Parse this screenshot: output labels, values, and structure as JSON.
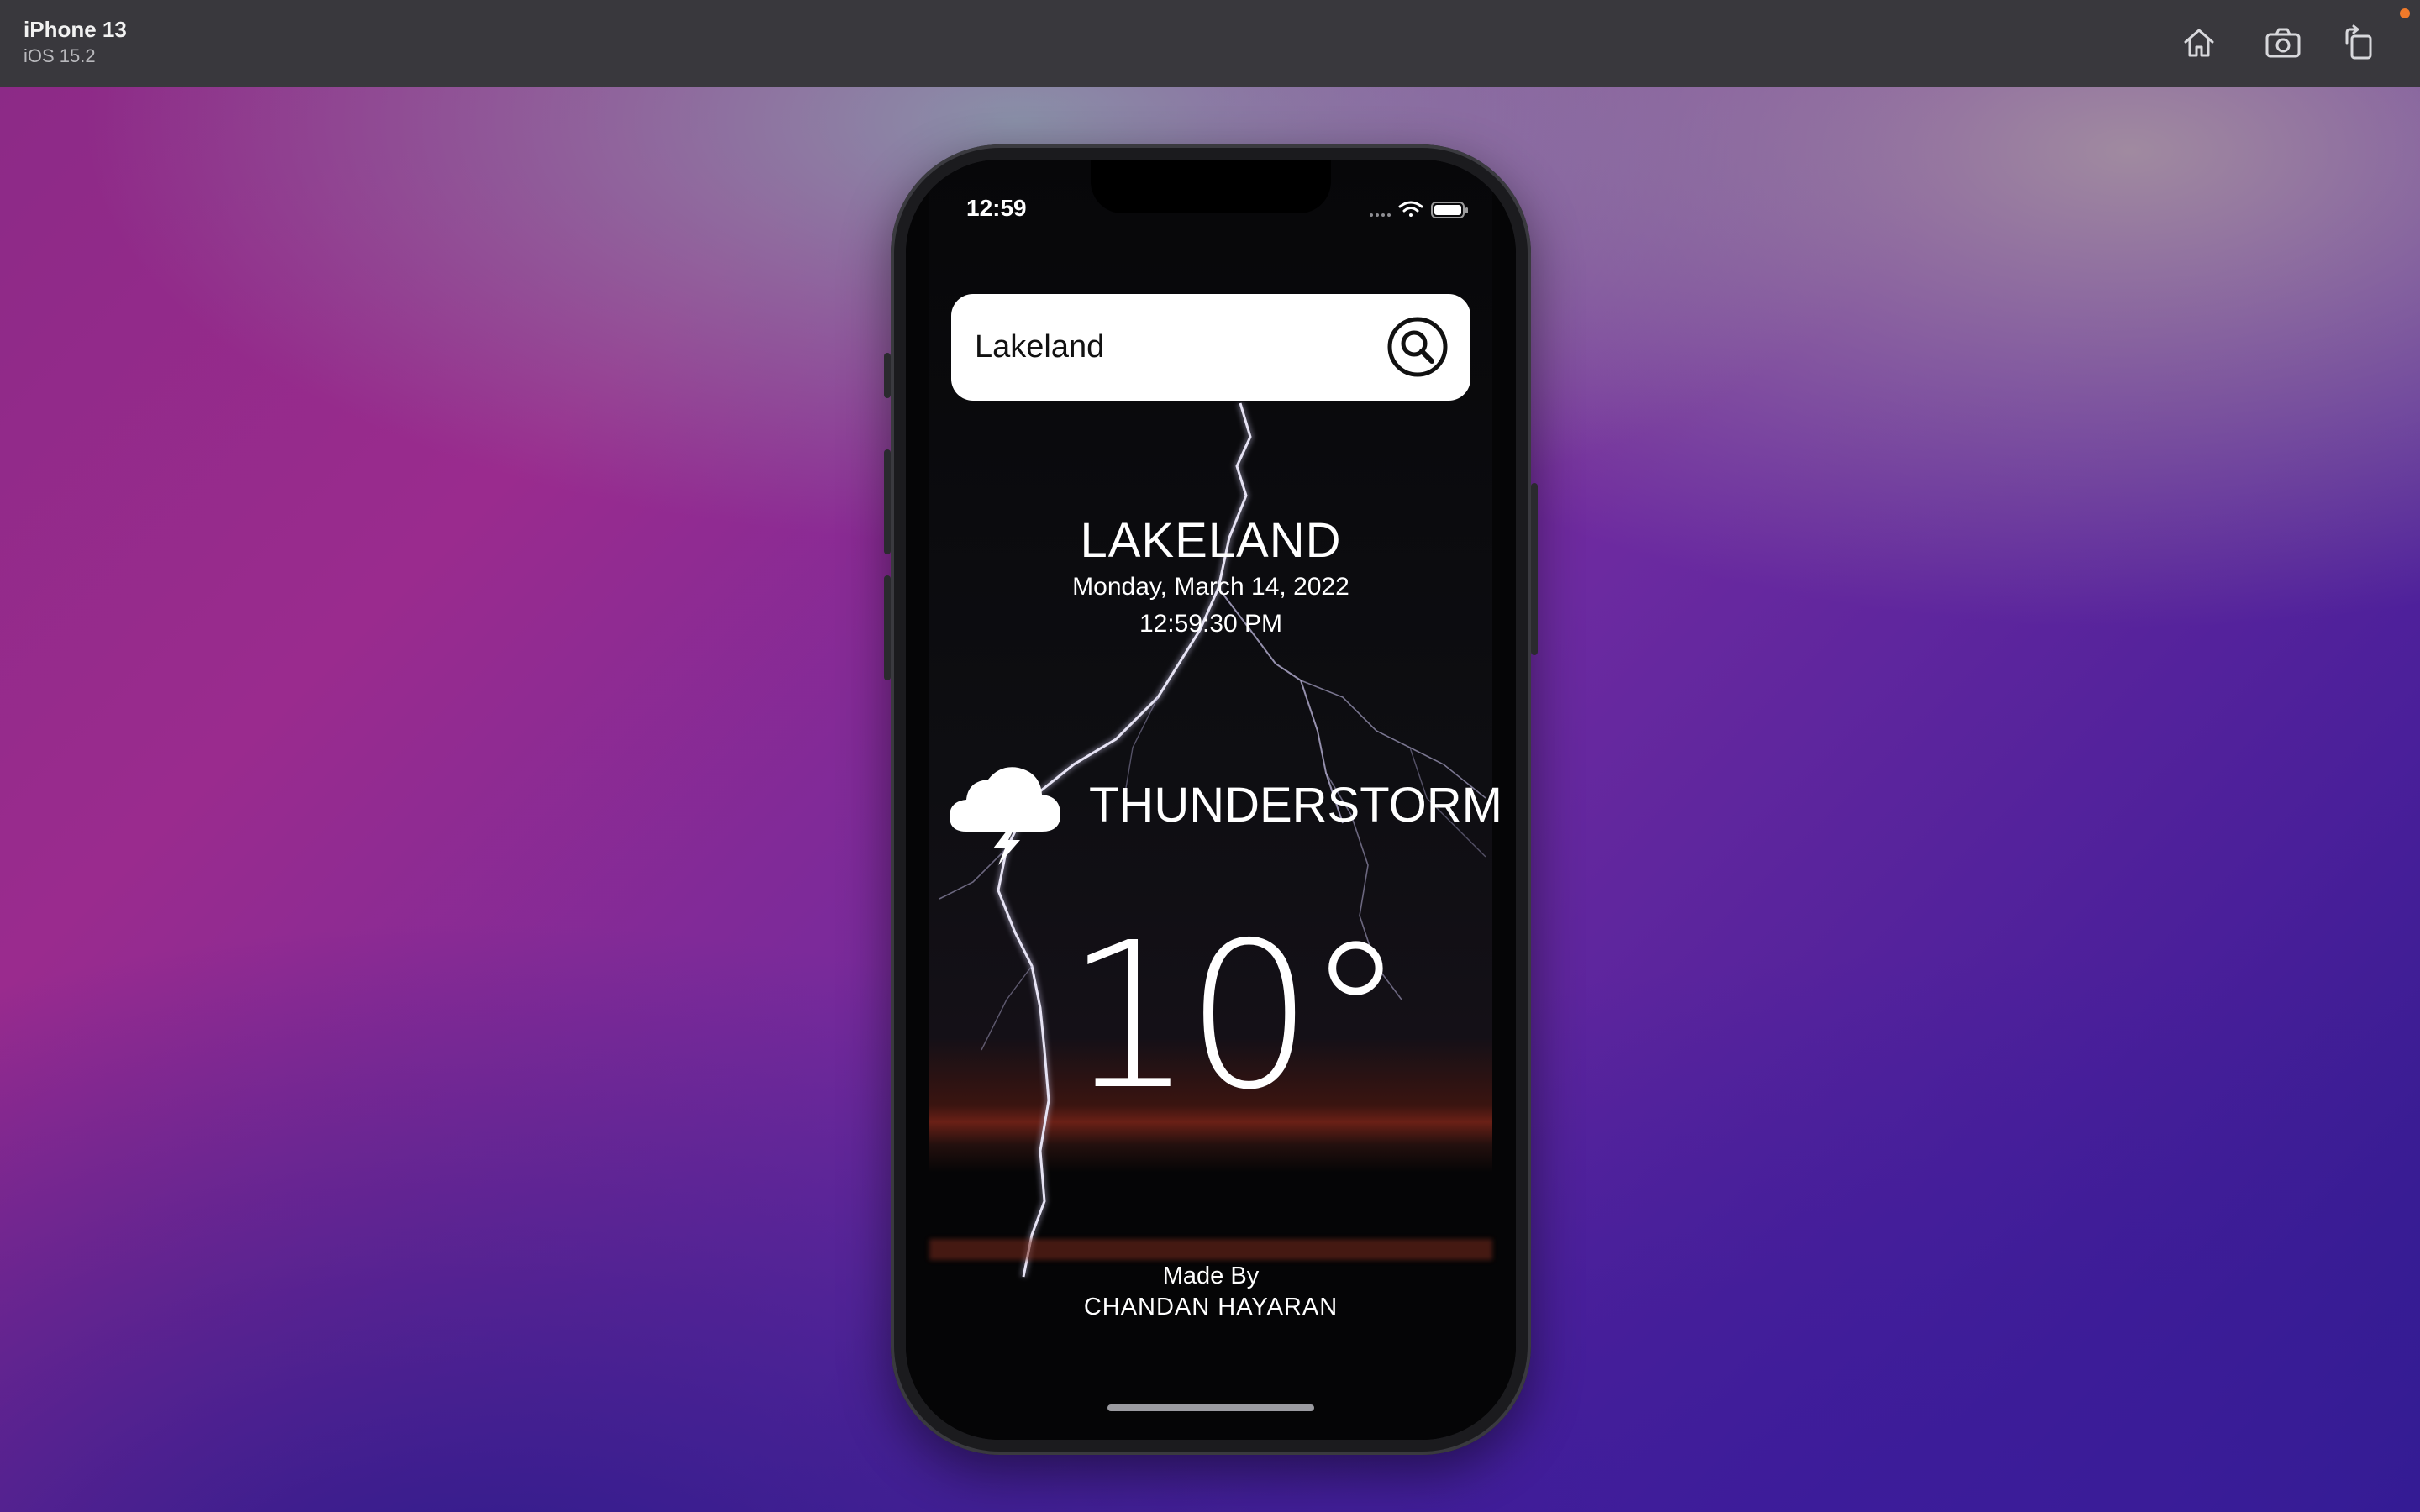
{
  "simulator": {
    "device_name": "iPhone 13",
    "os_version": "iOS 15.2",
    "toolbar": {
      "home_icon": "home-icon",
      "screenshot_icon": "camera-icon",
      "rotate_icon": "rotate-icon"
    }
  },
  "status_bar": {
    "time": "12:59",
    "icons": [
      "signal-dots-icon",
      "wifi-icon",
      "battery-icon"
    ]
  },
  "search": {
    "value": "Lakeland",
    "icon": "search-icon"
  },
  "weather": {
    "city": "LAKELAND",
    "date": "Monday, March 14, 2022",
    "time": "12:59:30 PM",
    "icon": "thunderstorm-icon",
    "condition": "THUNDERSTORM",
    "temperature": "10°"
  },
  "footer": {
    "made_by": "Made By",
    "author": "CHANDAN HAYARAN"
  },
  "colors": {
    "toolbar_bg": "#39383d",
    "accent_orange": "#f07a2a",
    "text": "#ffffff"
  }
}
